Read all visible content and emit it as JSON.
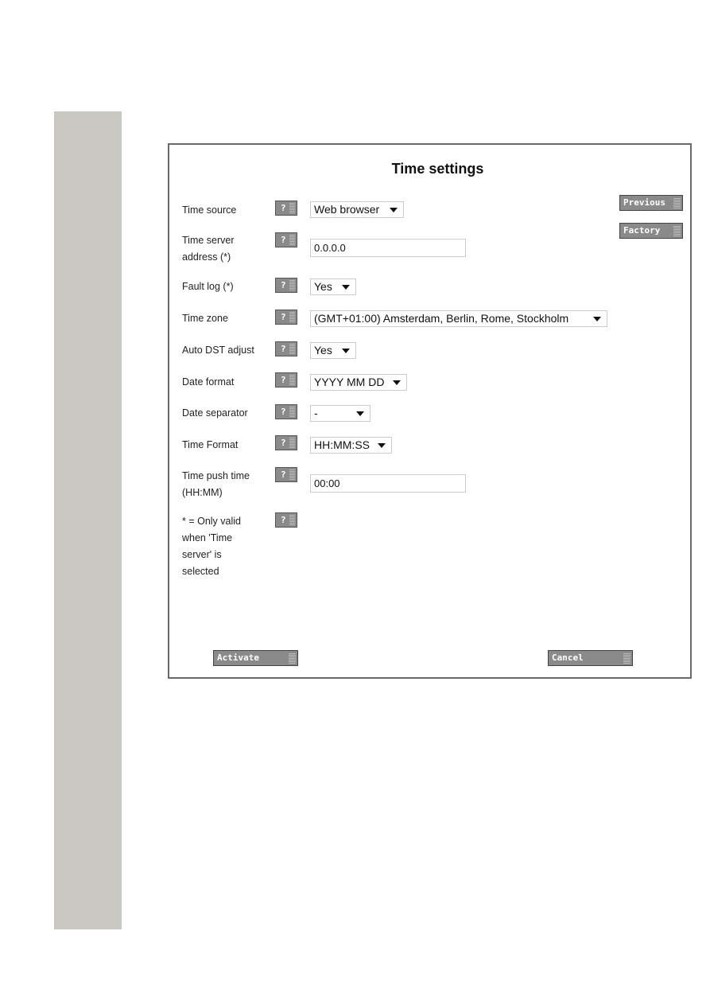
{
  "title": "Time settings",
  "help_label": "?",
  "fields": [
    {
      "label": "Time source",
      "value": "Web browser"
    },
    {
      "label": "Time server address (*)",
      "value": "0.0.0.0"
    },
    {
      "label": "Fault log (*)",
      "value": "Yes"
    },
    {
      "label": "Time zone",
      "value": "(GMT+01:00) Amsterdam, Berlin, Rome, Stockholm"
    },
    {
      "label": "Auto DST adjust",
      "value": "Yes"
    },
    {
      "label": "Date format",
      "value": "YYYY MM DD"
    },
    {
      "label": "Date separator",
      "value": "-"
    },
    {
      "label": "Time Format",
      "value": "HH:MM:SS"
    },
    {
      "label": "Time push time (HH:MM)",
      "value": "00:00"
    }
  ],
  "note": "* = Only valid when 'Time server' is selected",
  "buttons": {
    "previous": "Previous",
    "factory": "Factory",
    "activate": "Activate",
    "cancel": "Cancel"
  }
}
